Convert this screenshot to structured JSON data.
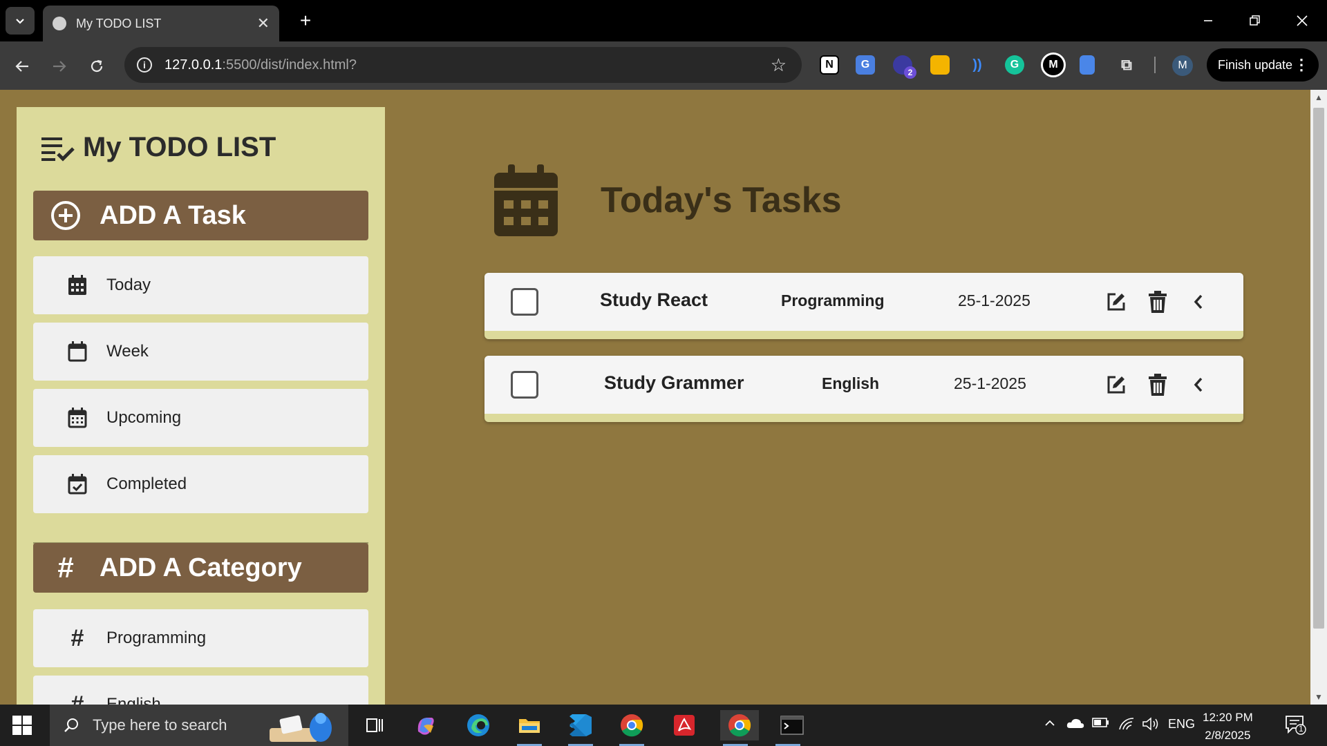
{
  "browser": {
    "tab_title": "My TODO LIST",
    "url_host": "127.0.0.1",
    "url_path": ":5500/dist/index.html?",
    "finish_update_label": "Finish update",
    "profile_initial": "M",
    "extension_badge": "2",
    "medium_initial": "M"
  },
  "sidebar": {
    "app_title": "My TODO LIST",
    "add_task_label": "ADD A Task",
    "nav_items": [
      {
        "label": "Today",
        "icon": "calendar-grid-icon"
      },
      {
        "label": "Week",
        "icon": "calendar-week-icon"
      },
      {
        "label": "Upcoming",
        "icon": "calendar-dots-icon"
      },
      {
        "label": "Completed",
        "icon": "calendar-check-icon"
      }
    ],
    "add_category_label": "ADD A Category",
    "categories": [
      {
        "label": "Programming"
      },
      {
        "label": "English"
      }
    ]
  },
  "main": {
    "title": "Today's Tasks",
    "tasks": [
      {
        "name": "Study React",
        "category": "Programming",
        "date": "25-1-2025",
        "done": false
      },
      {
        "name": "Study Grammer",
        "category": "English",
        "date": "25-1-2025",
        "done": false
      }
    ]
  },
  "taskbar": {
    "search_placeholder": "Type here to search",
    "language": "ENG",
    "time": "12:20 PM",
    "date": "2/8/2025",
    "notification_count": "1"
  },
  "colors": {
    "page_bg": "#8f773f",
    "sidebar_bg": "#dcda9b",
    "button_bg": "#7b5f42",
    "card_bg": "#f5f5f5"
  }
}
